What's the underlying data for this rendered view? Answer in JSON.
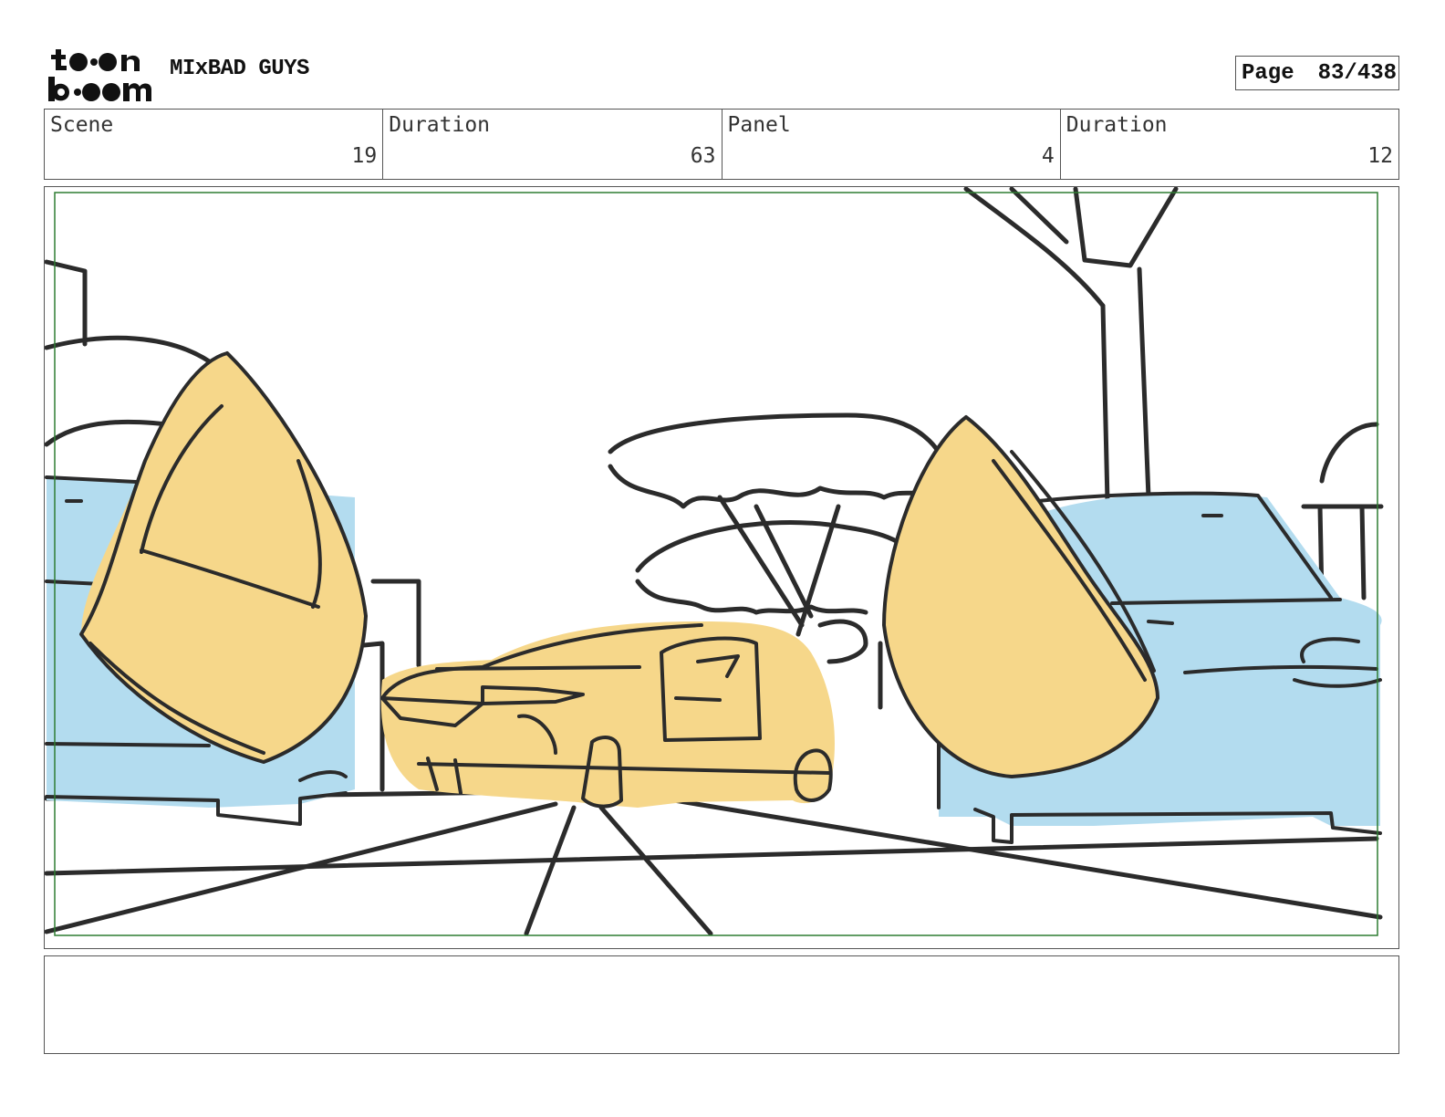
{
  "header": {
    "logo_text": "toon boom",
    "project_title": "MIxBAD GUYS",
    "page_label": "Page",
    "page_number": "83/438"
  },
  "info": {
    "scene_label": "Scene",
    "scene_value": "19",
    "scene_duration_label": "Duration",
    "scene_duration_value": "63",
    "panel_label": "Panel",
    "panel_value": "4",
    "panel_duration_label": "Duration",
    "panel_duration_value": "12"
  },
  "notes": {
    "text": ""
  },
  "colors": {
    "sketch_line": "#2b2b2b",
    "car_fill_blue": "#b3dcef",
    "character_fill_yellow": "#f6d78a",
    "safe_frame_green": "#2e7d32"
  }
}
